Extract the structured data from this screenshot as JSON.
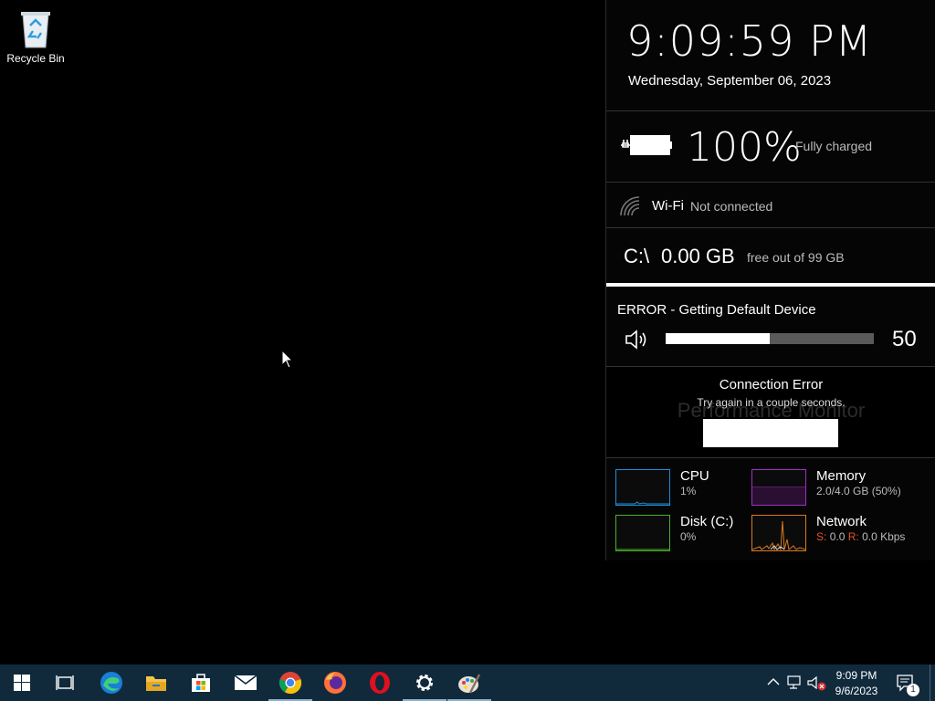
{
  "desktop": {
    "recycle_bin_label": "Recycle Bin"
  },
  "clock": {
    "time": "9:09:59 PM",
    "date": "Wednesday, September 06, 2023"
  },
  "battery": {
    "percent": "100%",
    "status": "Fully charged"
  },
  "wifi": {
    "name": "Wi-Fi",
    "status": "Not connected"
  },
  "disk": {
    "drive": "C:\\",
    "free": "0.00 GB",
    "total": "free out of 99 GB"
  },
  "volume": {
    "error": "ERROR - Getting Default Device",
    "level": 50,
    "level_label": "50"
  },
  "media": {
    "title": "Connection Error",
    "subtitle": "Try again in a couple seconds.",
    "ghost": "Performance Monitor"
  },
  "performance": {
    "cpu": {
      "name": "CPU",
      "value": "1%",
      "color": "#1e8fd9"
    },
    "memory": {
      "name": "Memory",
      "value": "2.0/4.0 GB (50%)",
      "color": "#a12fbf"
    },
    "disk": {
      "name": "Disk (C:)",
      "value": "0%",
      "color": "#4caf2a"
    },
    "network": {
      "name": "Network",
      "send_label": "S:",
      "send": "0.0",
      "recv_label": "R:",
      "recv": "0.0 Kbps",
      "color": "#d97a1e"
    }
  },
  "taskbar": {
    "apps": [
      "start-icon",
      "task-view-icon",
      "edge-icon",
      "file-explorer-icon",
      "store-icon",
      "mail-icon",
      "chrome-icon",
      "firefox-icon",
      "opera-icon",
      "settings-icon",
      "paint-icon"
    ],
    "time": "9:09 PM",
    "date": "9/6/2023",
    "notification_count": "1"
  }
}
